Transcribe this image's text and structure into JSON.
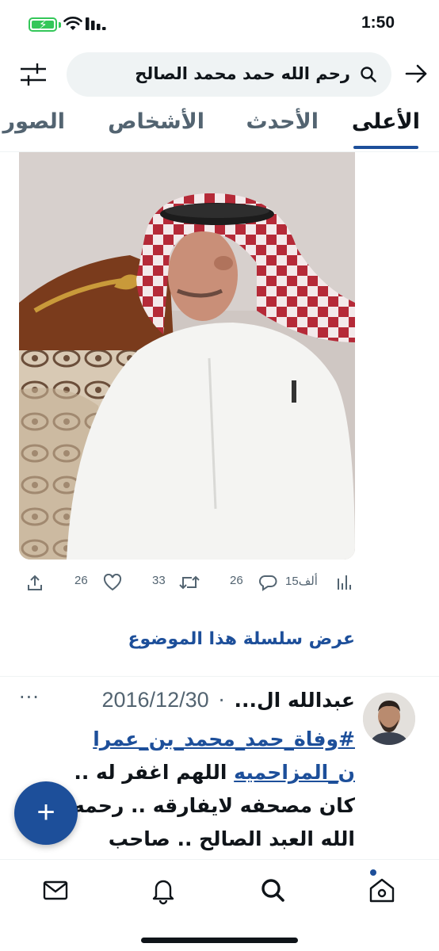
{
  "status_bar": {
    "time": "1:50",
    "battery_color": "#34c759"
  },
  "search": {
    "query": "رحم الله حمد محمد الصالح",
    "icons": {
      "filter": "sliders-icon",
      "search": "search-icon",
      "back": "arrow-right-icon"
    }
  },
  "tabs": [
    {
      "label": "الأعلى",
      "active": true
    },
    {
      "label": "الأحدث",
      "active": false
    },
    {
      "label": "الأشخاص",
      "active": false
    },
    {
      "label": "الصور",
      "active": false
    }
  ],
  "media": {
    "alt_icon": "photo-elderly-man-in-shemagh"
  },
  "actions": {
    "views": "15ألف",
    "replies": "26",
    "retweets": "33",
    "likes": "26"
  },
  "thread_link": "عرض سلسلة هذا الموضوع",
  "tweet": {
    "name": "عبدالله ال...",
    "date": "2016/12/30",
    "dot": "·",
    "more": "···",
    "hashtag_line1": "#وفاة_حمد_محمد_بن_عمرا",
    "hashtag_line2": "ن_المزاحميه",
    "body_line2_rest": " اللهم اغفر له ..",
    "body_line3": "كان مصحفه لايفارقه .. رحمه",
    "body_line4": "الله العبد الصالح .. صاحب"
  },
  "fab": {
    "label": "+"
  },
  "bottom_nav": [
    "mail-icon",
    "bell-icon",
    "search-icon",
    "home-icon"
  ],
  "colors": {
    "accent": "#1d4f9a",
    "secondary_text": "#536471",
    "primary_text": "#0f1419"
  }
}
